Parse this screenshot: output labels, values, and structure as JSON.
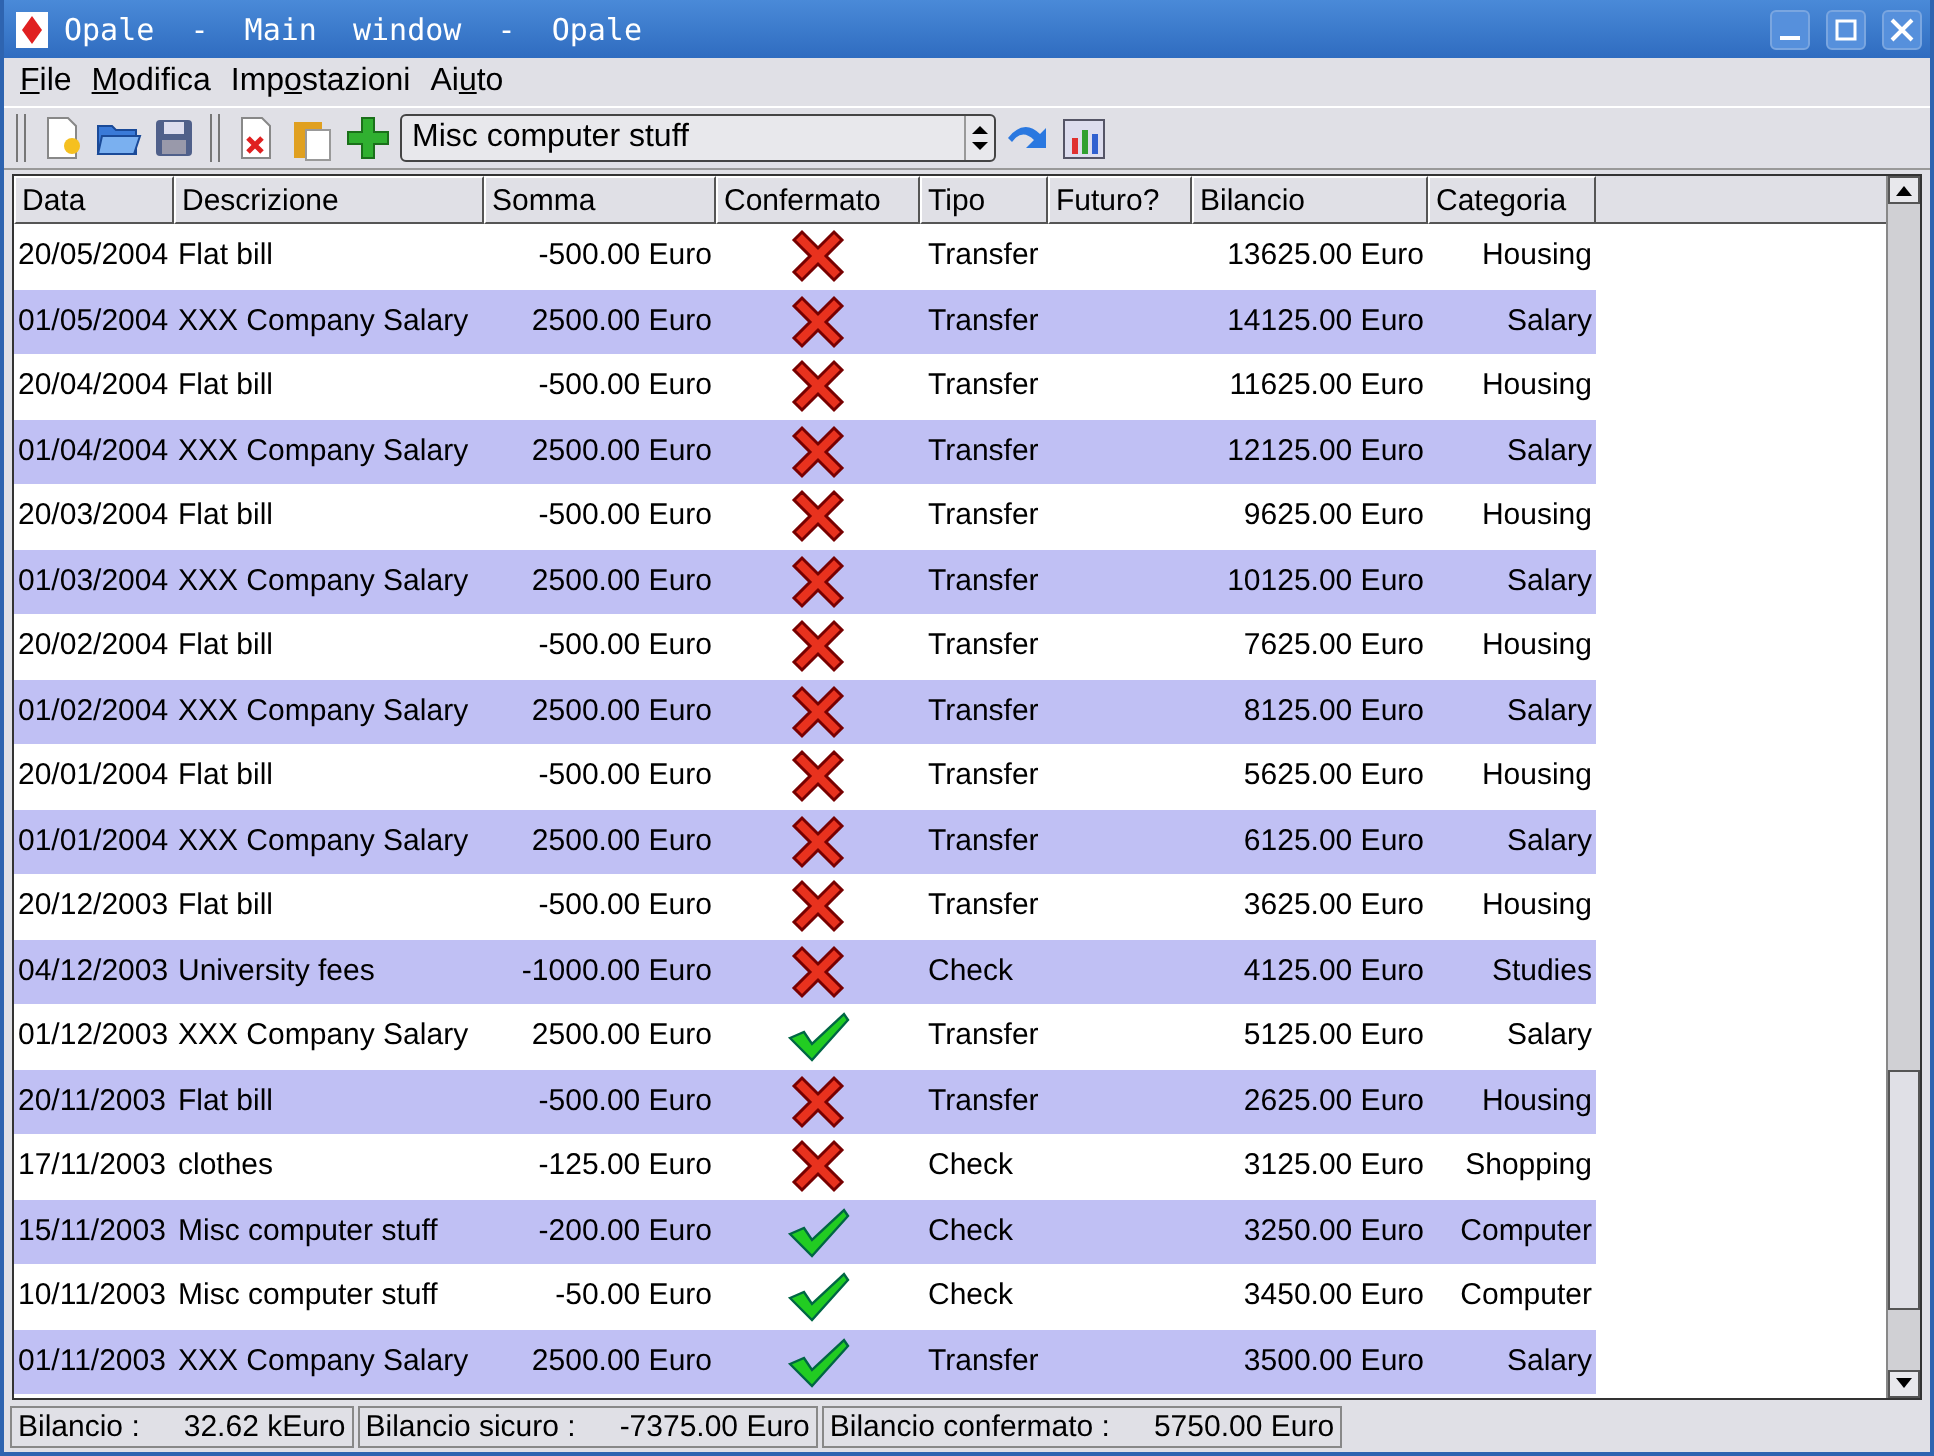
{
  "window": {
    "title": "Opale  -  Main  window  -  Opale"
  },
  "menu": [
    "File",
    "Modifica",
    "Impostazioni",
    "Aiuto"
  ],
  "toolbar": {
    "account": "Misc computer stuff"
  },
  "table": {
    "columns": [
      "Data",
      "Descrizione",
      "Somma",
      "Confermato",
      "Tipo",
      "Futuro?",
      "Bilancio",
      "Categoria"
    ],
    "rows": [
      {
        "date": "20/05/2004",
        "description": "Flat bill",
        "amount": "-500.00 Euro",
        "confirmed": false,
        "type": "Transfer",
        "balance": "13625.00 Euro",
        "category": "Housing"
      },
      {
        "date": "01/05/2004",
        "description": "XXX Company Salary",
        "amount": "2500.00 Euro",
        "confirmed": false,
        "type": "Transfer",
        "balance": "14125.00 Euro",
        "category": "Salary"
      },
      {
        "date": "20/04/2004",
        "description": "Flat bill",
        "amount": "-500.00 Euro",
        "confirmed": false,
        "type": "Transfer",
        "balance": "11625.00 Euro",
        "category": "Housing"
      },
      {
        "date": "01/04/2004",
        "description": "XXX Company Salary",
        "amount": "2500.00 Euro",
        "confirmed": false,
        "type": "Transfer",
        "balance": "12125.00 Euro",
        "category": "Salary"
      },
      {
        "date": "20/03/2004",
        "description": "Flat bill",
        "amount": "-500.00 Euro",
        "confirmed": false,
        "type": "Transfer",
        "balance": "9625.00 Euro",
        "category": "Housing"
      },
      {
        "date": "01/03/2004",
        "description": "XXX Company Salary",
        "amount": "2500.00 Euro",
        "confirmed": false,
        "type": "Transfer",
        "balance": "10125.00 Euro",
        "category": "Salary"
      },
      {
        "date": "20/02/2004",
        "description": "Flat bill",
        "amount": "-500.00 Euro",
        "confirmed": false,
        "type": "Transfer",
        "balance": "7625.00 Euro",
        "category": "Housing"
      },
      {
        "date": "01/02/2004",
        "description": "XXX Company Salary",
        "amount": "2500.00 Euro",
        "confirmed": false,
        "type": "Transfer",
        "balance": "8125.00 Euro",
        "category": "Salary"
      },
      {
        "date": "20/01/2004",
        "description": "Flat bill",
        "amount": "-500.00 Euro",
        "confirmed": false,
        "type": "Transfer",
        "balance": "5625.00 Euro",
        "category": "Housing"
      },
      {
        "date": "01/01/2004",
        "description": "XXX Company Salary",
        "amount": "2500.00 Euro",
        "confirmed": false,
        "type": "Transfer",
        "balance": "6125.00 Euro",
        "category": "Salary"
      },
      {
        "date": "20/12/2003",
        "description": "Flat bill",
        "amount": "-500.00 Euro",
        "confirmed": false,
        "type": "Transfer",
        "balance": "3625.00 Euro",
        "category": "Housing"
      },
      {
        "date": "04/12/2003",
        "description": "University fees",
        "amount": "-1000.00 Euro",
        "confirmed": false,
        "type": "Check",
        "balance": "4125.00 Euro",
        "category": "Studies"
      },
      {
        "date": "01/12/2003",
        "description": "XXX Company Salary",
        "amount": "2500.00 Euro",
        "confirmed": true,
        "type": "Transfer",
        "balance": "5125.00 Euro",
        "category": "Salary"
      },
      {
        "date": "20/11/2003",
        "description": "Flat bill",
        "amount": "-500.00 Euro",
        "confirmed": false,
        "type": "Transfer",
        "balance": "2625.00 Euro",
        "category": "Housing"
      },
      {
        "date": "17/11/2003",
        "description": "clothes",
        "amount": "-125.00 Euro",
        "confirmed": false,
        "type": "Check",
        "balance": "3125.00 Euro",
        "category": "Shopping"
      },
      {
        "date": "15/11/2003",
        "description": "Misc computer stuff",
        "amount": "-200.00 Euro",
        "confirmed": true,
        "type": "Check",
        "balance": "3250.00 Euro",
        "category": "Computer"
      },
      {
        "date": "10/11/2003",
        "description": "Misc computer stuff",
        "amount": "-50.00 Euro",
        "confirmed": true,
        "type": "Check",
        "balance": "3450.00 Euro",
        "category": "Computer"
      },
      {
        "date": "01/11/2003",
        "description": "XXX Company Salary",
        "amount": "2500.00 Euro",
        "confirmed": true,
        "type": "Transfer",
        "balance": "3500.00 Euro",
        "category": "Salary"
      }
    ]
  },
  "status_bar": [
    {
      "label": "Bilancio :",
      "value": "32.62 kEuro"
    },
    {
      "label": "Bilancio sicuro :",
      "value": "-7375.00 Euro"
    },
    {
      "label": "Bilancio confermato :",
      "value": "5750.00 Euro"
    }
  ]
}
